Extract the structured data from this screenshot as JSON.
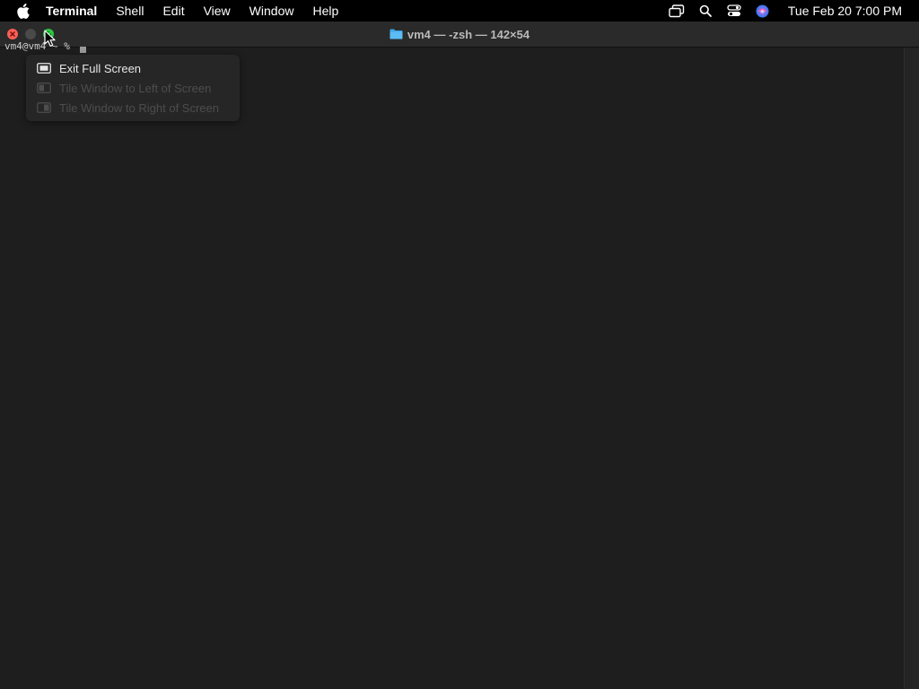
{
  "menubar": {
    "apple_icon": "apple-logo-icon",
    "app_name": "Terminal",
    "items": [
      "Shell",
      "Edit",
      "View",
      "Window",
      "Help"
    ],
    "status_icons": [
      "screen-mirroring-icon",
      "spotlight-search-icon",
      "control-center-icon",
      "siri-icon"
    ],
    "clock": "Tue Feb 20  7:00 PM"
  },
  "window": {
    "title": "vm4 — -zsh — 142×54",
    "title_icon": "folder-icon",
    "colors": {
      "close": "#ff5f57",
      "zoom": "#28c840",
      "background": "#1e1e1e"
    }
  },
  "terminal": {
    "prompt": "vm4@vm4 ~ %"
  },
  "popover": {
    "items": [
      {
        "label": "Exit Full Screen",
        "icon": "exit-full-screen-icon",
        "enabled": true
      },
      {
        "label": "Tile Window to Left of Screen",
        "icon": "tile-left-icon",
        "enabled": false
      },
      {
        "label": "Tile Window to Right of Screen",
        "icon": "tile-right-icon",
        "enabled": false
      }
    ]
  }
}
